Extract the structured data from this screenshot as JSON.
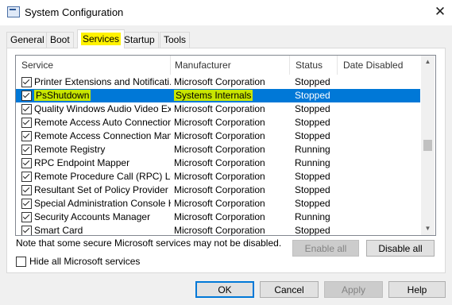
{
  "window": {
    "title": "System Configuration",
    "close_glyph": "✕"
  },
  "tabs": [
    {
      "label": "General"
    },
    {
      "label": "Boot"
    },
    {
      "label": "Services"
    },
    {
      "label": "Startup"
    },
    {
      "label": "Tools"
    }
  ],
  "list": {
    "headers": [
      "Service",
      "Manufacturer",
      "Status",
      "Date Disabled"
    ],
    "rows": [
      {
        "name": "Printer Extensions and Notificati...",
        "manufacturer": "Microsoft Corporation",
        "status": "Stopped",
        "checked": true
      },
      {
        "name": "PsShutdown",
        "manufacturer": "Systems Internals",
        "status": "Stopped",
        "checked": true,
        "selected": true
      },
      {
        "name": "Quality Windows Audio Video Ex...",
        "manufacturer": "Microsoft Corporation",
        "status": "Stopped",
        "checked": true
      },
      {
        "name": "Remote Access Auto Connection...",
        "manufacturer": "Microsoft Corporation",
        "status": "Stopped",
        "checked": true
      },
      {
        "name": "Remote Access Connection Man...",
        "manufacturer": "Microsoft Corporation",
        "status": "Stopped",
        "checked": true
      },
      {
        "name": "Remote Registry",
        "manufacturer": "Microsoft Corporation",
        "status": "Running",
        "checked": true
      },
      {
        "name": "RPC Endpoint Mapper",
        "manufacturer": "Microsoft Corporation",
        "status": "Running",
        "checked": true
      },
      {
        "name": "Remote Procedure Call (RPC) Lo...",
        "manufacturer": "Microsoft Corporation",
        "status": "Stopped",
        "checked": true
      },
      {
        "name": "Resultant Set of Policy Provider",
        "manufacturer": "Microsoft Corporation",
        "status": "Stopped",
        "checked": true
      },
      {
        "name": "Special Administration Console H...",
        "manufacturer": "Microsoft Corporation",
        "status": "Stopped",
        "checked": true
      },
      {
        "name": "Security Accounts Manager",
        "manufacturer": "Microsoft Corporation",
        "status": "Running",
        "checked": true
      },
      {
        "name": "Smart Card",
        "manufacturer": "Microsoft Corporation",
        "status": "Stopped",
        "checked": true
      }
    ]
  },
  "note": "Note that some secure Microsoft services may not be disabled.",
  "buttons": {
    "enable_all": "Enable all",
    "disable_all": "Disable all",
    "ok": "OK",
    "cancel": "Cancel",
    "apply": "Apply",
    "help": "Help"
  },
  "hide_ms": {
    "label": "Hide all Microsoft services",
    "checked": false
  },
  "colors": {
    "selection": "#0078d7",
    "highlight_yellow": "#fff200",
    "highlight_green": "#c8e600"
  }
}
